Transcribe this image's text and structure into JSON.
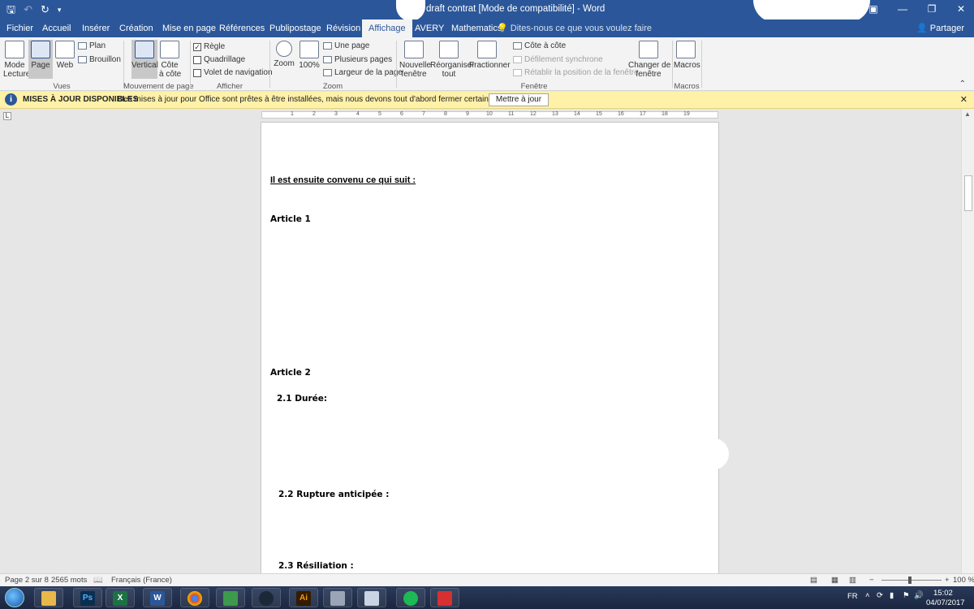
{
  "titlebar": {
    "title": "draft contrat [Mode de compatibilité]  -  Word",
    "save_icon": "save-icon",
    "undo_icon": "undo-icon",
    "redo_icon": "redo-icon"
  },
  "tabs": [
    {
      "label": "Fichier"
    },
    {
      "label": "Accueil"
    },
    {
      "label": "Insérer"
    },
    {
      "label": "Création"
    },
    {
      "label": "Mise en page"
    },
    {
      "label": "Références"
    },
    {
      "label": "Publipostage"
    },
    {
      "label": "Révision"
    },
    {
      "label": "Affichage"
    },
    {
      "label": "AVERY"
    },
    {
      "label": "Mathematics"
    }
  ],
  "tell_me": "Dites-nous ce que vous voulez faire",
  "share": "Partager",
  "ribbon": {
    "mode_lecture": "Mode\nLecture",
    "page": "Page",
    "web": "Web",
    "plan": "Plan",
    "brouillon": "Brouillon",
    "vertical": "Vertical",
    "cote_a_cote": "Côte\nà côte",
    "regle": "Règle",
    "quadrillage": "Quadrillage",
    "volet": "Volet de navigation",
    "zoom": "Zoom",
    "zoom100": "100%",
    "une_page": "Une page",
    "plusieurs_pages": "Plusieurs pages",
    "largeur_page": "Largeur de la page",
    "nouvelle_fenetre": "Nouvelle\nfenêtre",
    "reorganiser": "Réorganiser\ntout",
    "fractionner": "Fractionner",
    "cote_a_cote_small": "Côte à côte",
    "defilement": "Défilement synchrone",
    "retablir": "Rétablir la position de la fenêtre",
    "changer_fenetre": "Changer de\nfenêtre",
    "macros": "Macros",
    "groups": {
      "vues": "Vues",
      "mouvement": "Mouvement de page",
      "afficher": "Afficher",
      "zoom": "Zoom",
      "fenetre": "Fenêtre",
      "macros": "Macros"
    }
  },
  "infobar": {
    "title": "MISES À JOUR DISPONIBLES",
    "message": "Des mises à jour pour Office sont prêtes à être installées, mais nous devons tout d'abord fermer certaines applications.",
    "button": "Mettre à jour"
  },
  "document": {
    "intro": "Il est ensuite convenu ce qui suit :",
    "article1": "Article 1",
    "article2": "Article 2",
    "sec21": "2.1  Durée:",
    "sec22": "2.2  Rupture anticipée :",
    "sec23": "2.3  Résiliation :"
  },
  "statusbar": {
    "page": "Page 2 sur 8",
    "words": "2565 mots",
    "language": "Français (France)",
    "zoom": "100 %"
  },
  "tray": {
    "lang": "FR",
    "time": "15:02",
    "date": "04/07/2017"
  }
}
